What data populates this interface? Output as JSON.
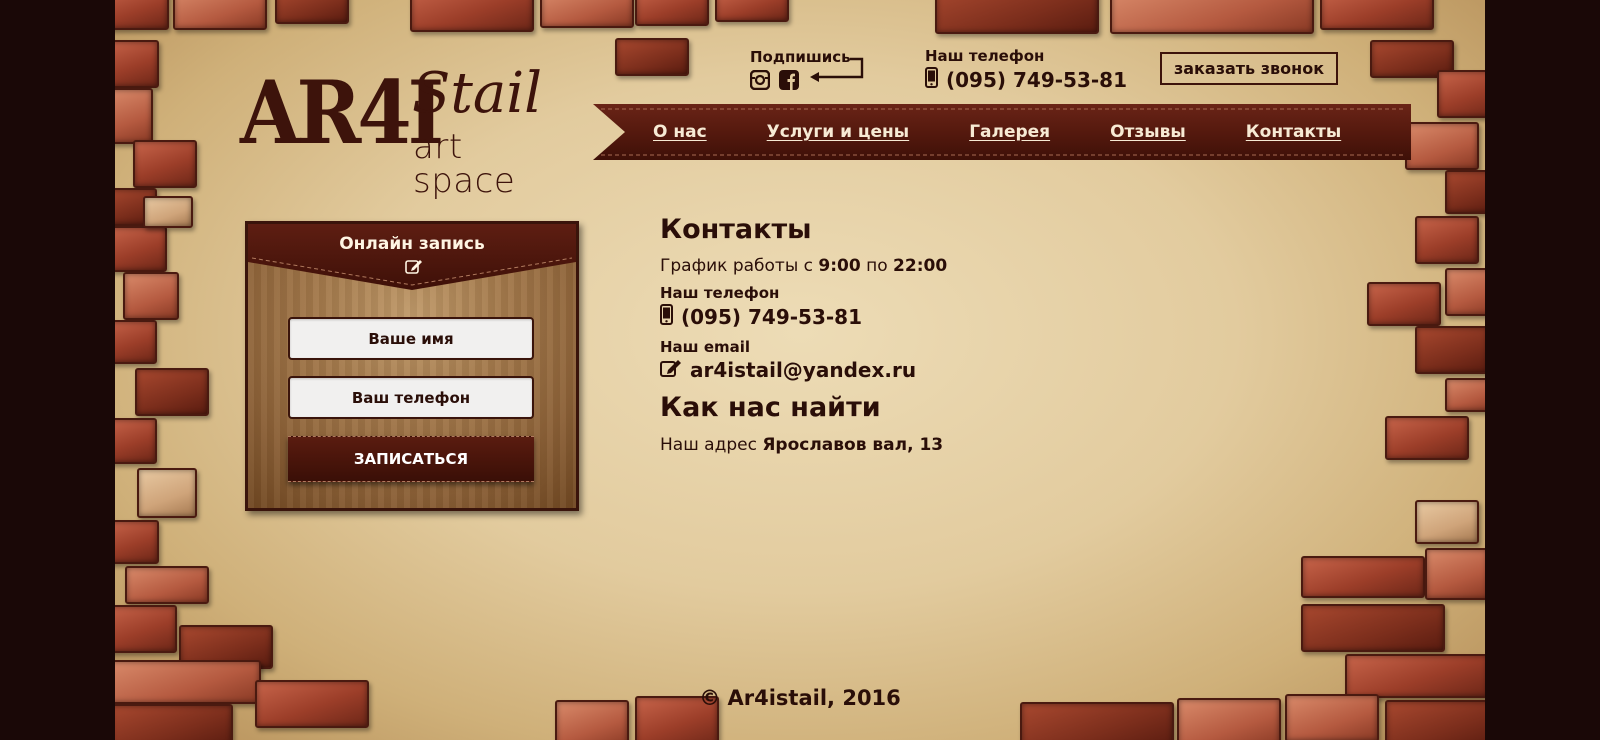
{
  "logo": {
    "main": "AR4I",
    "script": "Stail",
    "subtitle": "art space"
  },
  "header": {
    "subscribe_label": "Подпишись",
    "social": [
      "instagram-icon",
      "facebook-icon"
    ],
    "phone_label": "Наш телефон",
    "phone_number": "(095) 749-53-81",
    "callback_button": "заказать звонок"
  },
  "nav": {
    "items": [
      {
        "label": "О нас"
      },
      {
        "label": "Услуги и цены"
      },
      {
        "label": "Галерея"
      },
      {
        "label": "Отзывы"
      },
      {
        "label": "Контакты"
      }
    ]
  },
  "booking": {
    "title": "Онлайн запись",
    "name_placeholder": "Ваше имя",
    "phone_placeholder": "Ваш телефон",
    "submit_label": "ЗАПИСАТЬСЯ"
  },
  "contacts": {
    "heading": "Контакты",
    "schedule_prefix": "График работы с ",
    "schedule_from": "9:00",
    "schedule_mid": " по ",
    "schedule_to": "22:00",
    "phone_label": "Наш телефон",
    "phone": "(095) 749-53-81",
    "email_label": "Наш email",
    "email": "ar4istail@yandex.ru",
    "find_heading": "Как нас найти",
    "address_prefix": "Наш адрес ",
    "address": "Ярославов вал, 13"
  },
  "footer": {
    "copyright": "© Ar4istail, 2016"
  },
  "colors": {
    "dark_brown": "#3d130b",
    "paper": "#e2cb9e",
    "brick": "#9c3e29",
    "outer_background": "#1a0807"
  }
}
